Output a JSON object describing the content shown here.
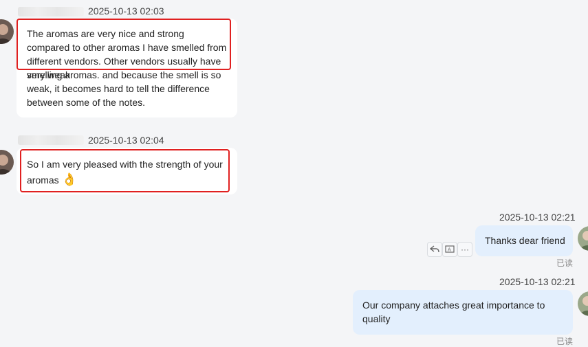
{
  "messages": [
    {
      "time": "2025-10-13 02:03",
      "text_highlighted": "The aromas are very nice and strong compared to other aromas I have smelled from different vendors. Other vendors usually have very weak",
      "text_rest": "smelling aromas. and because the smell is so weak, it becomes hard to tell the difference between some of the notes."
    },
    {
      "time": "2025-10-13 02:04",
      "text": "So I am very pleased with the strength of your aromas",
      "emoji": "👌"
    },
    {
      "time": "2025-10-13 02:21",
      "text": "Thanks dear friend",
      "status": "已读"
    },
    {
      "time": "2025-10-13 02:21",
      "text": "Our company attaches great importance to quality",
      "status": "已读"
    }
  ],
  "actions": {
    "reply_icon": "reply-icon",
    "translate_icon": "translate-icon",
    "more_label": "···"
  },
  "colors": {
    "highlight": "#e02020",
    "outgoing_bubble": "#e3effd",
    "incoming_bubble": "#ffffff"
  }
}
